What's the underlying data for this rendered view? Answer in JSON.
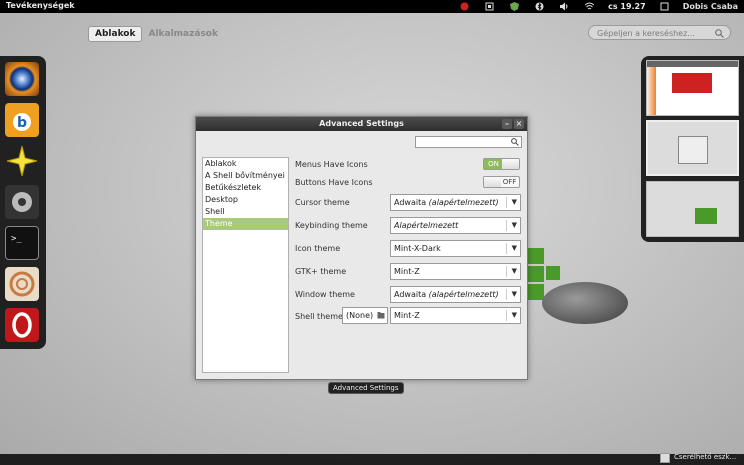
{
  "top_panel": {
    "activities": "Tevékenységek",
    "clock": "cs 19.27",
    "user": "Dobis Csaba"
  },
  "view_tabs": {
    "windows": "Ablakok",
    "applications": "Alkalmazások"
  },
  "search": {
    "placeholder": "Gépeljen a kereséshez..."
  },
  "dash": {
    "apps": [
      "eye-of-gnome-icon",
      "banshee-icon",
      "star-app-icon",
      "system-settings-icon",
      "terminal-icon",
      "shell-app-icon",
      "opera-icon"
    ]
  },
  "dialog": {
    "title": "Advanced Settings",
    "sections": [
      "Ablakok",
      "A Shell bővítményei",
      "Betűkészletek",
      "Desktop",
      "Shell",
      "Theme"
    ],
    "selected_section": "Theme",
    "menus_have_icons": {
      "label": "Menus Have Icons",
      "state": "ON"
    },
    "buttons_have_icons": {
      "label": "Buttons Have Icons",
      "state": "OFF"
    },
    "cursor_theme": {
      "label": "Cursor theme",
      "value": "Adwaita",
      "suffix": "(alapértelmezett)"
    },
    "keybinding_theme": {
      "label": "Keybinding theme",
      "value": "",
      "suffix": "Alapértelmezett"
    },
    "icon_theme": {
      "label": "Icon theme",
      "value": "Mint-X-Dark",
      "suffix": ""
    },
    "gtk_theme": {
      "label": "GTK+ theme",
      "value": "Mint-Z",
      "suffix": ""
    },
    "window_theme": {
      "label": "Window theme",
      "value": "Adwaita",
      "suffix": "(alapértelmezett)"
    },
    "shell_theme": {
      "label": "Shell theme",
      "file": "(None)",
      "value": "Mint-Z"
    }
  },
  "tooltip": "Advanced Settings",
  "notification": "Cserélhető eszk..."
}
